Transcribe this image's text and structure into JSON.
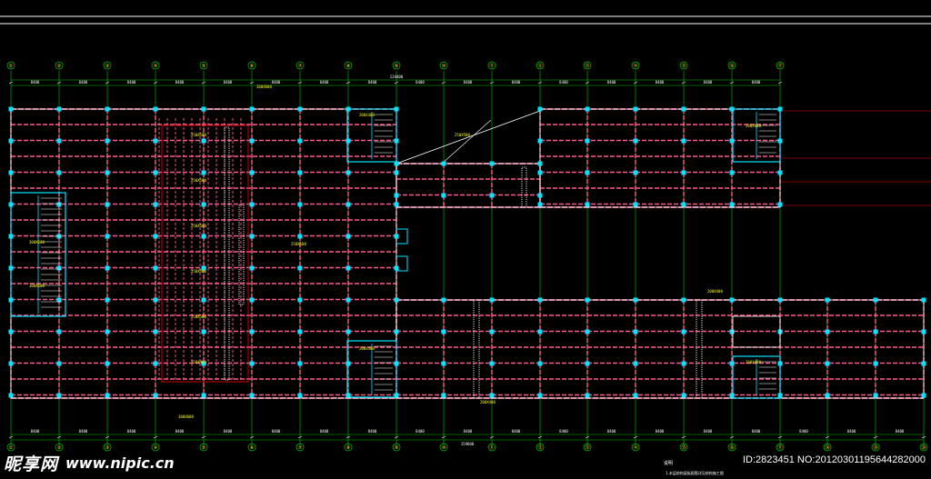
{
  "grid": {
    "top_axis_labels": [
      "①",
      "②",
      "③",
      "④",
      "⑤",
      "⑥",
      "⑦",
      "⑧",
      "⑨",
      "⑩",
      "⑪",
      "⑫",
      "⑬",
      "⑭",
      "⑮",
      "⑯",
      "⑰"
    ],
    "bottom_axis_labels": [
      "①",
      "②",
      "③",
      "④",
      "⑤",
      "⑥",
      "⑦",
      "⑧",
      "⑨",
      "⑩",
      "⑪",
      "⑫",
      "⑬",
      "⑭",
      "⑮",
      "⑯",
      "⑰",
      "⑱",
      "⑲",
      "⑳"
    ],
    "span_label": "8400",
    "total_top": "134400",
    "total_bottom": "159600"
  },
  "beam_labels": {
    "main": "250X500",
    "secondary": "200X400",
    "edge": "300X600",
    "small": "250X400"
  },
  "notes": {
    "title": "说明",
    "line1": "1.本层结构梁板配筋详见结构施工图"
  },
  "watermark": {
    "logo": "昵享网",
    "url": "www.nipic.cn",
    "id": "ID:2823451 NO:20120301195644282000"
  },
  "colors": {
    "background": "#000000",
    "grid_line": "#00c800",
    "beam": "#ff5a8c",
    "column": "#00e6ff",
    "wall": "#ffffff",
    "text": "#ffff00",
    "leader": "#ff0000"
  }
}
